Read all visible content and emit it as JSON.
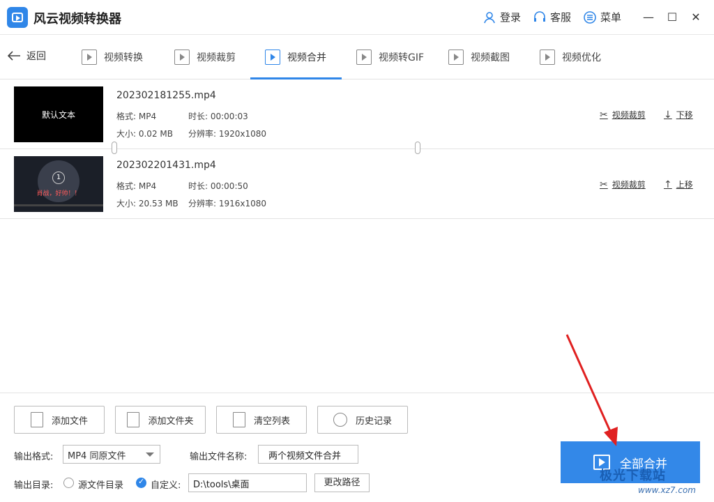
{
  "app": {
    "title": "风云视频转换器"
  },
  "header": {
    "login": "登录",
    "service": "客服",
    "menu": "菜单"
  },
  "nav": {
    "back": "返回",
    "tabs": [
      {
        "label": "视频转换"
      },
      {
        "label": "视频裁剪"
      },
      {
        "label": "视频合并"
      },
      {
        "label": "视频转GIF"
      },
      {
        "label": "视频截图"
      },
      {
        "label": "视频优化"
      }
    ],
    "active_tab": "视频合并"
  },
  "files": [
    {
      "name": "202302181255.mp4",
      "thumb_text": "默认文本",
      "format": "格式: MP4",
      "duration": "时长: 00:00:03",
      "size": "大小: 0.02 MB",
      "resolution": "分辨率: 1920x1080",
      "crop": "视频裁剪",
      "move": "下移"
    },
    {
      "name": "202302201431.mp4",
      "thumb_text": "肖战，好帅！！",
      "thumb_number": "1",
      "format": "格式: MP4",
      "duration": "时长: 00:00:50",
      "size": "大小: 20.53 MB",
      "resolution": "分辨率: 1916x1080",
      "crop": "视频裁剪",
      "move": "上移"
    }
  ],
  "toolbar": {
    "add_file": "添加文件",
    "add_folder": "添加文件夹",
    "clear_list": "清空列表",
    "history": "历史记录"
  },
  "output": {
    "format_label": "输出格式:",
    "format_value": "MP4 同原文件",
    "name_label": "输出文件名称:",
    "name_value": "两个视频文件合并",
    "dir_label": "输出目录:",
    "dir_source": "源文件目录",
    "dir_custom": "自定义:",
    "dir_selected": "自定义",
    "path_value": "D:\\tools\\桌面",
    "change_path": "更改路径"
  },
  "merge_button": "全部合并",
  "watermark": {
    "text": "极光下载站",
    "url": "www.xz7.com"
  },
  "colors": {
    "accent": "#2f86e8",
    "annotation_arrow": "#e02020"
  }
}
